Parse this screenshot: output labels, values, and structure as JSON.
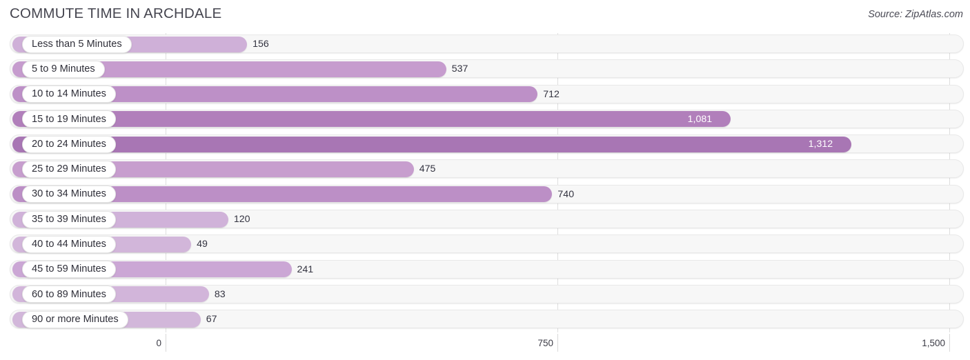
{
  "header": {
    "title": "COMMUTE TIME IN ARCHDALE",
    "source": "Source: ZipAtlas.com"
  },
  "chart_data": {
    "type": "bar",
    "orientation": "horizontal",
    "title": "COMMUTE TIME IN ARCHDALE",
    "xlabel": "",
    "ylabel": "",
    "xlim": [
      0,
      1500
    ],
    "ticks": [
      "0",
      "750",
      "1,500"
    ],
    "tick_values": [
      0,
      750,
      1500
    ],
    "grid": true,
    "legend": "none",
    "categories": [
      "Less than 5 Minutes",
      "5 to 9 Minutes",
      "10 to 14 Minutes",
      "15 to 19 Minutes",
      "20 to 24 Minutes",
      "25 to 29 Minutes",
      "30 to 34 Minutes",
      "35 to 39 Minutes",
      "40 to 44 Minutes",
      "45 to 59 Minutes",
      "60 to 89 Minutes",
      "90 or more Minutes"
    ],
    "values": [
      156,
      537,
      712,
      1081,
      1312,
      475,
      740,
      120,
      49,
      241,
      83,
      67
    ],
    "value_labels": [
      "156",
      "537",
      "712",
      "1,081",
      "1,312",
      "475",
      "740",
      "120",
      "49",
      "241",
      "83",
      "67"
    ],
    "label_inside": [
      false,
      false,
      false,
      true,
      true,
      false,
      false,
      false,
      false,
      false,
      false,
      false
    ],
    "bar_colors": [
      "#cfb0d8",
      "#c69cce",
      "#bd90c7",
      "#b17fbb",
      "#a876b4",
      "#c79ece",
      "#bc8fc6",
      "#d0b2d9",
      "#d2b6da",
      "#cba7d5",
      "#d2b5da",
      "#d2b7da"
    ]
  },
  "colors": {
    "accent": "#b17fbb",
    "track": "#f7f7f7",
    "grid": "#dedede",
    "text": "#3c3c46"
  }
}
